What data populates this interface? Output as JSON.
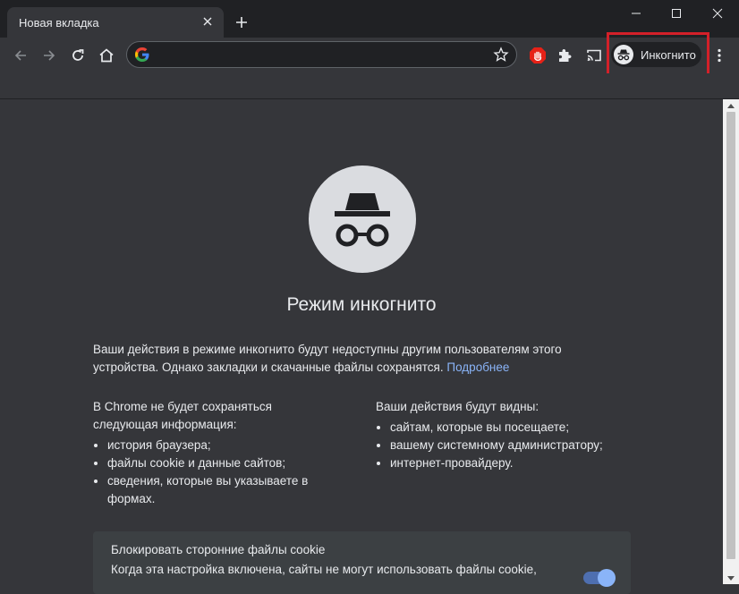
{
  "window": {
    "tab_title": "Новая вкладка"
  },
  "omnibox": {
    "value": "",
    "placeholder": ""
  },
  "profile": {
    "label": "Инкогнито"
  },
  "content": {
    "headline": "Режим инкогнито",
    "intro": "Ваши действия в режиме инкогнито будут недоступны другим пользователям этого устройства. Однако закладки и скачанные файлы сохранятся.",
    "learn_more": "Подробнее",
    "not_saved": {
      "heading": "В Chrome не будет сохраняться следующая информация:",
      "items": [
        "история браузера;",
        "файлы cookie и данные сайтов;",
        "сведения, которые вы указываете в формах."
      ]
    },
    "visible_to": {
      "heading": "Ваши действия будут видны:",
      "items": [
        "сайтам, которые вы посещаете;",
        "вашему системному администратору;",
        "интернет-провайдеру."
      ]
    },
    "cookie_card": {
      "title": "Блокировать сторонние файлы cookie",
      "description": "Когда эта настройка включена, сайты не могут использовать файлы cookie,",
      "toggle_on": true
    }
  },
  "colors": {
    "accent": "#8ab4f8",
    "highlight": "#d32029",
    "background": "#35363a"
  }
}
